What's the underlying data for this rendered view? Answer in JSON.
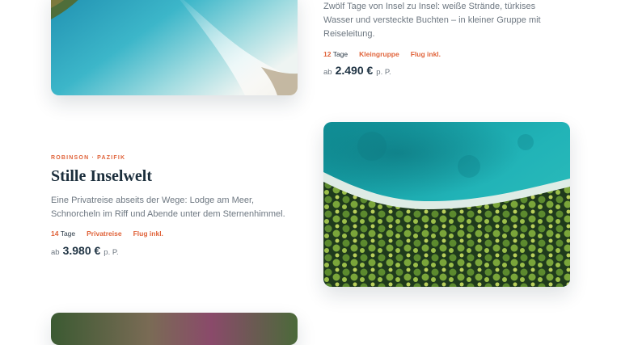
{
  "trip_top": {
    "description": "Zwölf Tage von Insel zu Insel: weiße Strände, türkises Wasser und versteckte Buchten – in kleiner Gruppe mit Reiseleitung.",
    "days_num": "12",
    "days_label": "Tage",
    "tag1": "Kleingruppe",
    "tag2": "Flug inkl.",
    "price_prefix": "ab",
    "price": "2.490 €",
    "price_suffix": "p. P."
  },
  "trip_main": {
    "eyebrow": "ROBINSON · PAZIFIK",
    "title": "Stille Inselwelt",
    "description": "Eine Privatreise abseits der Wege: Lodge am Meer, Schnorcheln im Riff und Abende unter dem Sternenhimmel.",
    "days_num": "14",
    "days_label": "Tage",
    "tag1": "Privatreise",
    "tag2": "Flug inkl.",
    "price_prefix": "ab",
    "price": "3.980 €",
    "price_suffix": "p. P."
  },
  "colors": {
    "accent": "#e0633a",
    "heading": "#1b2e3c",
    "body_text": "#6d7781",
    "lagoon": "#1fb0b8"
  }
}
